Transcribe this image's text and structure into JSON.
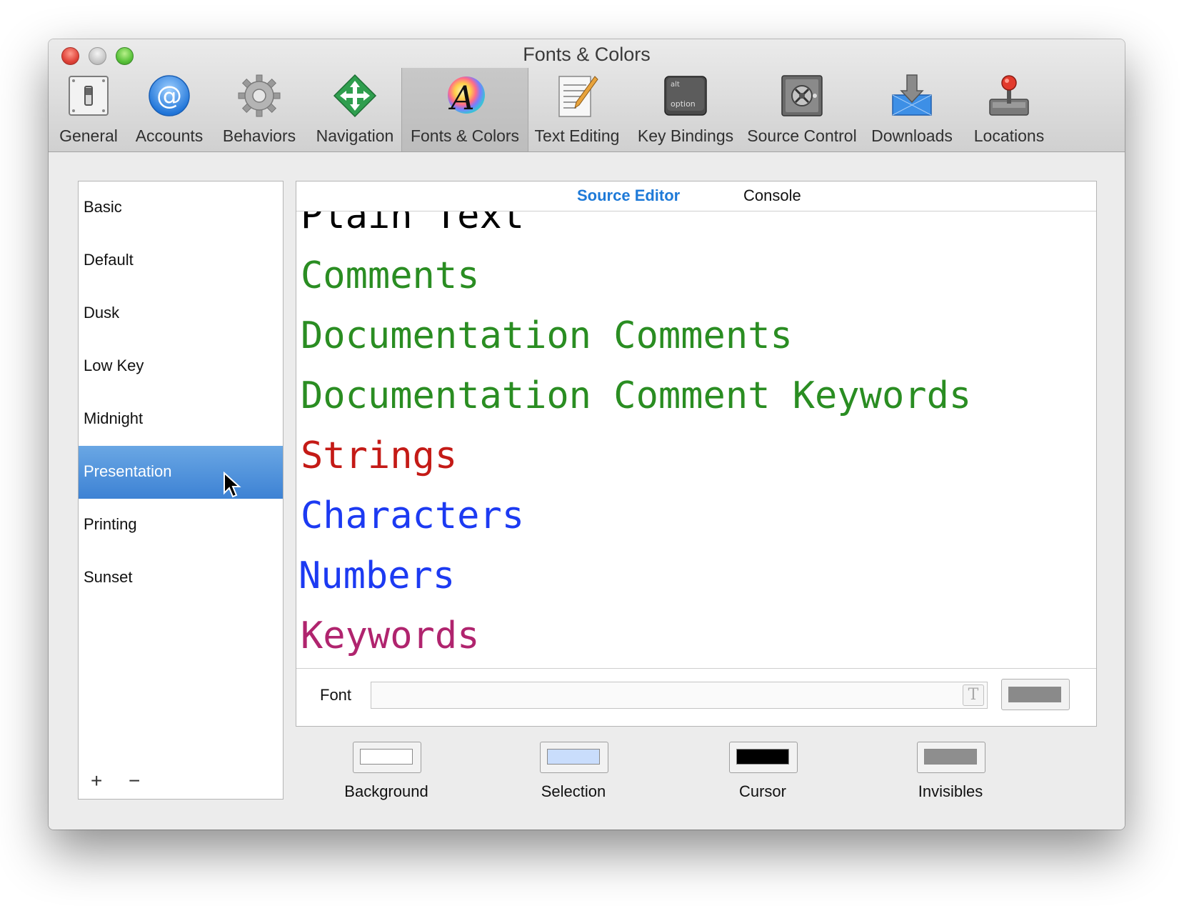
{
  "window": {
    "title": "Fonts & Colors"
  },
  "toolbar": {
    "items": [
      {
        "label": "General"
      },
      {
        "label": "Accounts"
      },
      {
        "label": "Behaviors"
      },
      {
        "label": "Navigation"
      },
      {
        "label": "Fonts & Colors"
      },
      {
        "label": "Text Editing"
      },
      {
        "label": "Key Bindings"
      },
      {
        "label": "Source Control"
      },
      {
        "label": "Downloads"
      },
      {
        "label": "Locations"
      }
    ],
    "keycap_top": "alt",
    "keycap_bottom": "option"
  },
  "themes": {
    "items": [
      {
        "label": "Basic"
      },
      {
        "label": "Default"
      },
      {
        "label": "Dusk"
      },
      {
        "label": "Low Key"
      },
      {
        "label": "Midnight"
      },
      {
        "label": "Presentation"
      },
      {
        "label": "Printing"
      },
      {
        "label": "Sunset"
      }
    ],
    "selected": "Presentation",
    "add_label": "+",
    "remove_label": "−"
  },
  "editor": {
    "tabs": [
      {
        "label": "Source Editor"
      },
      {
        "label": "Console"
      }
    ],
    "active_tab": "Source Editor",
    "preview": [
      {
        "label": "Plain Text",
        "color": "#000000"
      },
      {
        "label": "Comments",
        "color": "#2a8d22"
      },
      {
        "label": "Documentation Comments",
        "color": "#2a8d22"
      },
      {
        "label": "Documentation Comment Keywords",
        "color": "#2a8d22"
      },
      {
        "label": "Strings",
        "color": "#c41a16"
      },
      {
        "label": "Characters",
        "color": "#1c3af2"
      },
      {
        "label": "Numbers",
        "color": "#1c3af2"
      },
      {
        "label": "Keywords",
        "color": "#b0246e"
      }
    ],
    "font_label": "Font",
    "font_value": "",
    "font_picker_glyph": "T",
    "font_color": "#8a8a8a"
  },
  "swatches": [
    {
      "label": "Background",
      "color": "#ffffff"
    },
    {
      "label": "Selection",
      "color": "#c9ddfc"
    },
    {
      "label": "Cursor",
      "color": "#000000"
    },
    {
      "label": "Invisibles",
      "color": "#8e8e8e"
    }
  ]
}
